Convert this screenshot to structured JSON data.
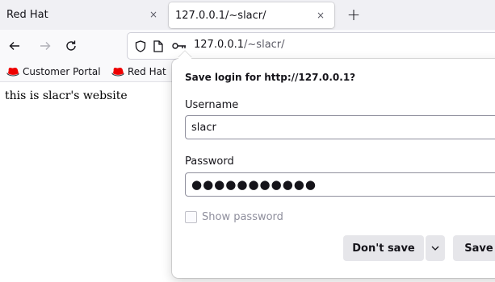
{
  "tabs": [
    {
      "title": "Red Hat",
      "active": false
    },
    {
      "title": "127.0.0.1/~slacr/",
      "active": true
    }
  ],
  "tab_close_glyph": "×",
  "new_tab_glyph": "+",
  "nav": {
    "back_icon": "arrow-left-icon",
    "forward_icon": "arrow-right-icon",
    "reload_icon": "reload-icon"
  },
  "url": {
    "host": "127.0.0.1",
    "path": "/~slacr/"
  },
  "bookmarks": [
    {
      "label": "Customer Portal",
      "icon": "redhat-favicon-icon"
    },
    {
      "label": "Red Hat",
      "icon": "redhat-favicon-icon"
    }
  ],
  "page": {
    "text": "this is slacr's website"
  },
  "login_panel": {
    "title": "Save login for http://127.0.0.1?",
    "username_label": "Username",
    "username_value": "slacr",
    "password_label": "Password",
    "password_mask": "●●●●●●●●●●●",
    "show_password_label": "Show password",
    "show_password_checked": false,
    "dont_save_label": "Don't save",
    "save_label": "Save"
  },
  "colors": {
    "tabstrip_bg": "#f0f0f4",
    "toolbar_bg": "#f9f9fb",
    "button_bg": "#e6e6ea",
    "redhat_red": "#ee0000"
  }
}
